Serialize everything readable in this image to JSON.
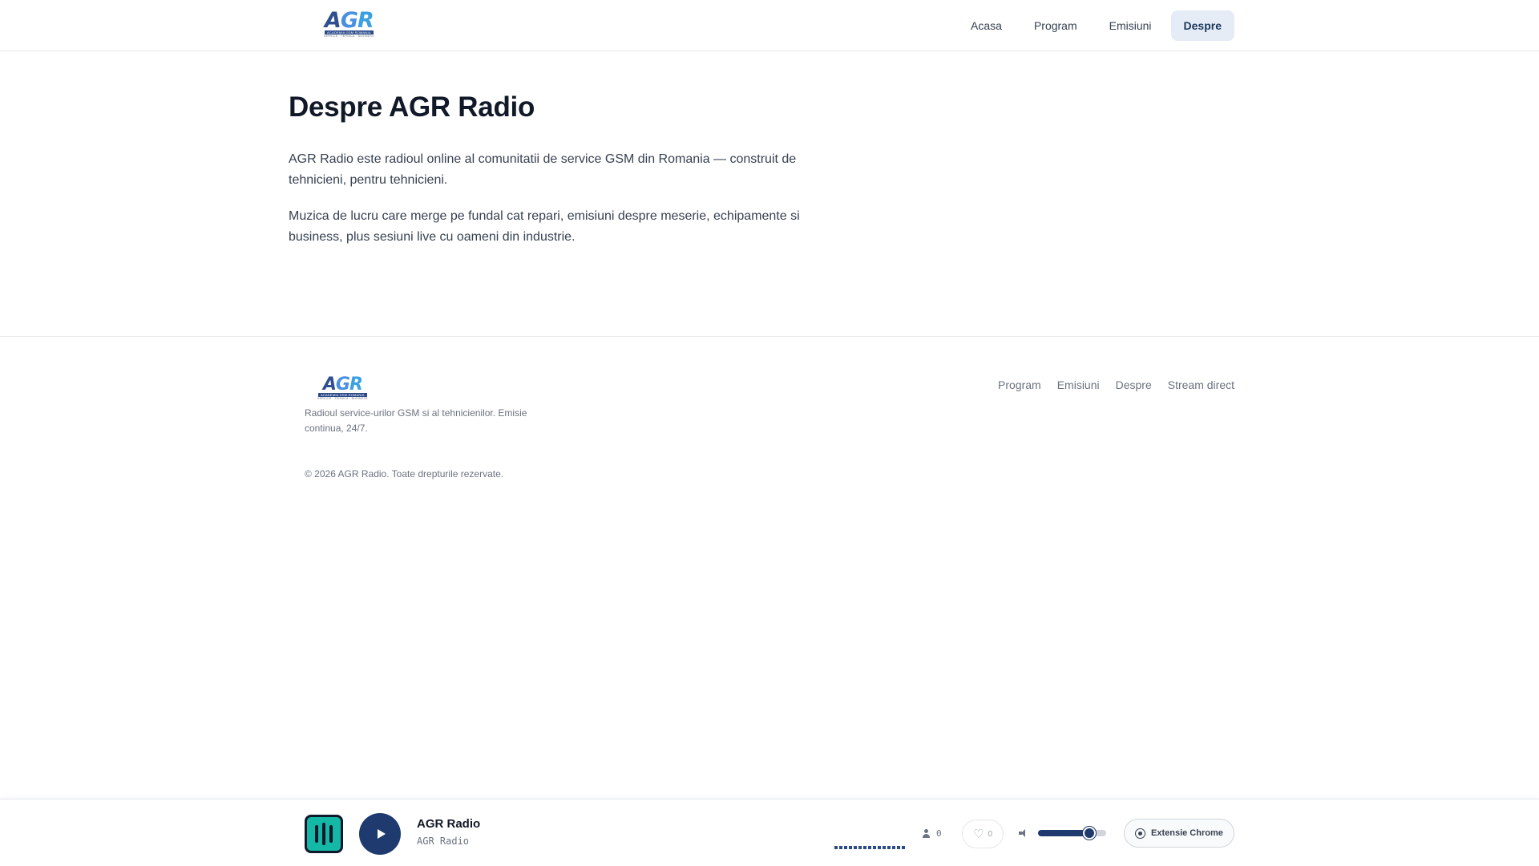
{
  "header": {
    "logo": {
      "main_a": "A",
      "main_g": "G",
      "main_r": "R",
      "bar": "ACADEMIA GSM ROMANIA",
      "sub": "SERVICE · TEHNICA · BUSINESS"
    },
    "nav": [
      {
        "label": "Acasa",
        "active": false
      },
      {
        "label": "Program",
        "active": false
      },
      {
        "label": "Emisiuni",
        "active": false
      },
      {
        "label": "Despre",
        "active": true
      }
    ]
  },
  "main": {
    "title": "Despre AGR Radio",
    "paragraphs": [
      "AGR Radio este radioul online al comunitatii de service GSM din Romania — construit de tehnicieni, pentru tehnicieni.",
      "Muzica de lucru care merge pe fundal cat repari, emisiuni despre meserie, echipamente si business, plus sesiuni live cu oameni din industrie."
    ]
  },
  "footer": {
    "logo": {
      "main_a": "A",
      "main_g": "G",
      "main_r": "R",
      "bar": "ACADEMIA GSM ROMANIA",
      "sub": "SERVICE · TEHNICA · BUSINESS"
    },
    "description": "Radioul service-urilor GSM si al tehnicienilor. Emisie continua, 24/7.",
    "links": [
      "Program",
      "Emisiuni",
      "Despre",
      "Stream direct"
    ],
    "copyright": "© 2026 AGR Radio. Toate drepturile rezervate."
  },
  "player": {
    "title": "AGR Radio",
    "subtitle": "AGR Radio",
    "listeners": "0",
    "likes": "0",
    "volume": 0.75,
    "extension_label": "Extensie Chrome",
    "icons": {
      "art": "equalizer-art-icon",
      "play": "play-icon",
      "listeners": "person-icon",
      "like": "heart-icon",
      "volume": "volume-icon",
      "extension": "chrome-icon"
    },
    "colors": {
      "accent": "#1e3a6e",
      "art": "#14b8a6"
    }
  }
}
